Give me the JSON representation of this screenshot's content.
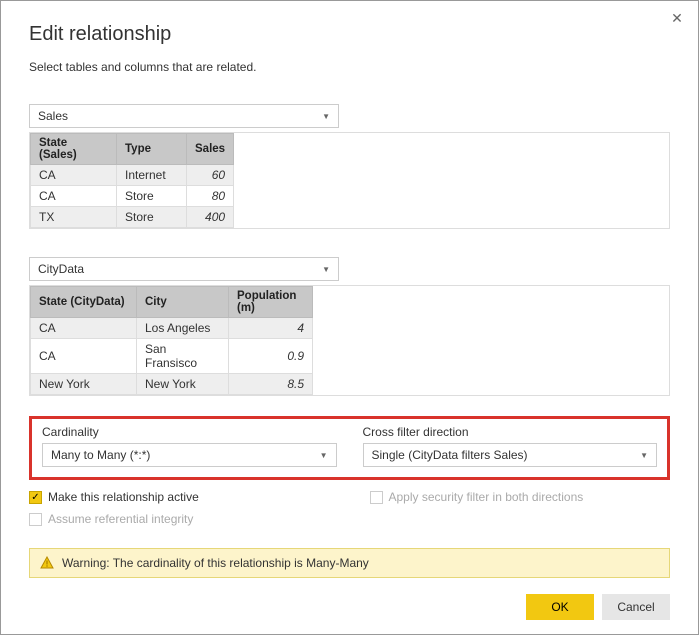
{
  "dialog": {
    "title": "Edit relationship",
    "subtitle": "Select tables and columns that are related."
  },
  "table1": {
    "selected": "Sales",
    "columns": [
      "State (Sales)",
      "Type",
      "Sales"
    ],
    "rows": [
      {
        "state": "CA",
        "type": "Internet",
        "sales": "60"
      },
      {
        "state": "CA",
        "type": "Store",
        "sales": "80"
      },
      {
        "state": "TX",
        "type": "Store",
        "sales": "400"
      }
    ]
  },
  "table2": {
    "selected": "CityData",
    "columns": [
      "State (CityData)",
      "City",
      "Population (m)"
    ],
    "rows": [
      {
        "state": "CA",
        "city": "Los Angeles",
        "pop": "4"
      },
      {
        "state": "CA",
        "city": "San Fransisco",
        "pop": "0.9"
      },
      {
        "state": "New York",
        "city": "New York",
        "pop": "8.5"
      }
    ]
  },
  "cardinality": {
    "label": "Cardinality",
    "value": "Many to Many (*:*)"
  },
  "crossfilter": {
    "label": "Cross filter direction",
    "value": "Single (CityData filters Sales)"
  },
  "checks": {
    "active": "Make this relationship active",
    "security": "Apply security filter in both directions",
    "referential": "Assume referential integrity"
  },
  "warning": {
    "text": "Warning: The cardinality of this relationship is Many-Many"
  },
  "buttons": {
    "ok": "OK",
    "cancel": "Cancel"
  }
}
